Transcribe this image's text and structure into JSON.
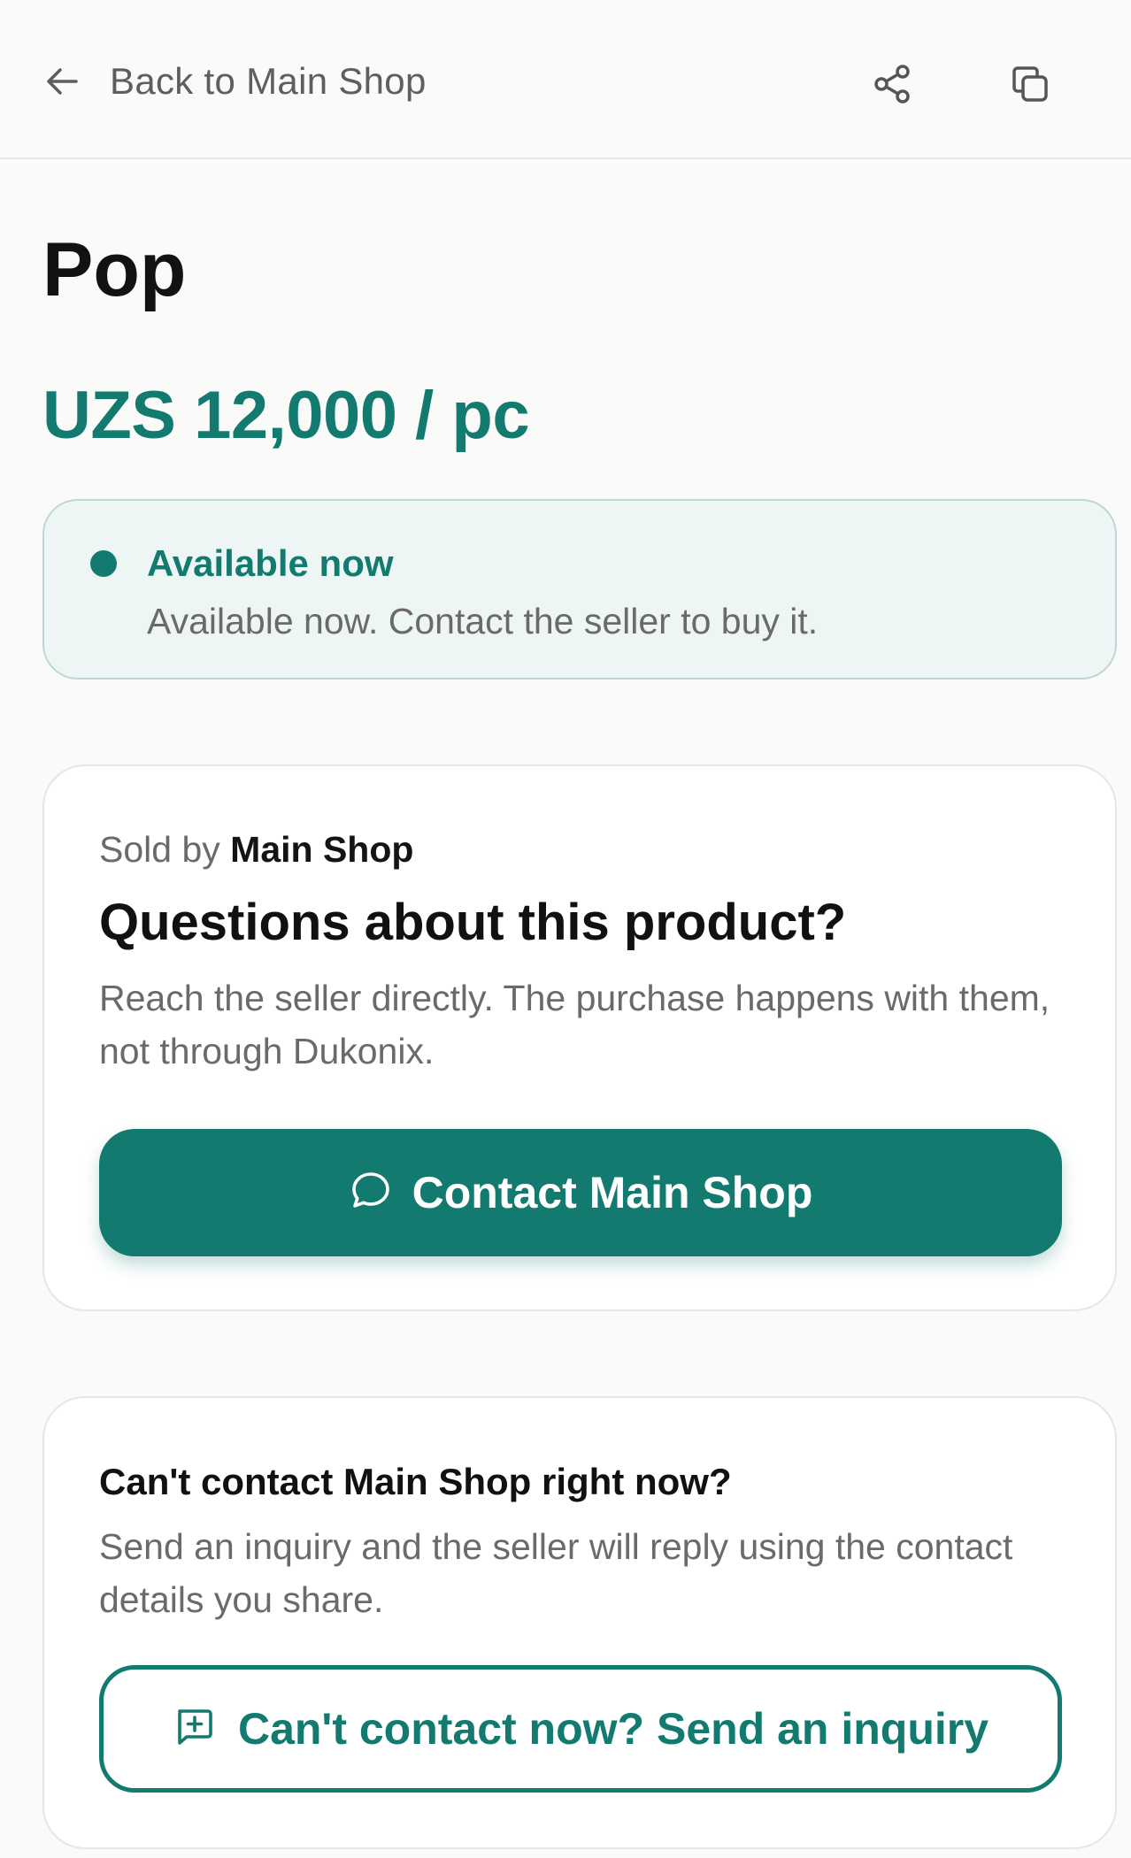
{
  "header": {
    "back_label": "Back to Main Shop",
    "icons": {
      "back": "arrow-left-icon",
      "share": "share-icon",
      "copy": "copy-icon"
    }
  },
  "product": {
    "name": "Pop",
    "price": "UZS 12,000 / pc"
  },
  "availability": {
    "title": "Available now",
    "description": "Available now. Contact the seller to buy it."
  },
  "seller_card": {
    "sold_by_prefix": "Sold by",
    "shop_name": "Main Shop",
    "heading": "Questions about this product?",
    "description": "Reach the seller directly. The purchase happens with them, not through Dukonix.",
    "contact_button_label": "Contact Main Shop",
    "contact_icon": "chat-bubble-icon"
  },
  "inquiry_card": {
    "heading": "Can't contact Main Shop right now?",
    "description": "Send an inquiry and the seller will reply using the contact details you share.",
    "button_label": "Can't contact now? Send an inquiry",
    "button_icon": "message-plus-icon"
  },
  "colors": {
    "accent": "#127a6f",
    "background": "#fafaf9",
    "status_background": "#edf6f5",
    "muted_text": "#6a6a6a"
  }
}
